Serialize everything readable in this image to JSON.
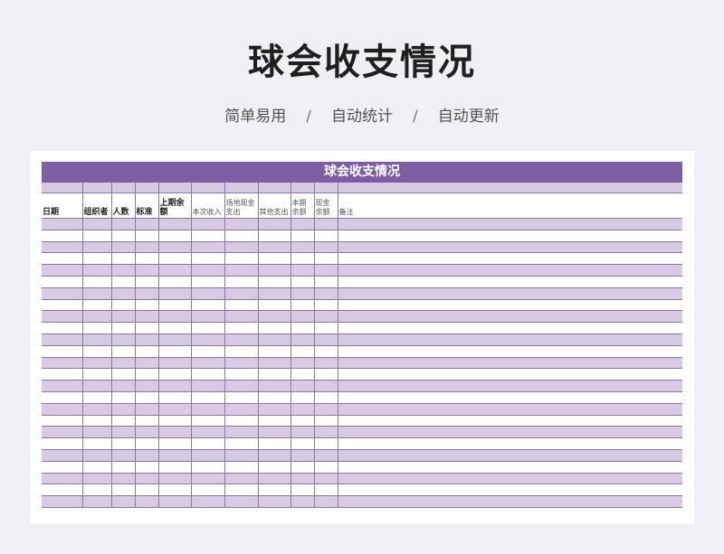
{
  "page": {
    "title": "球会收支情况",
    "tags": [
      "简单易用",
      "自动统计",
      "自动更新"
    ],
    "separator": "/"
  },
  "sheet": {
    "title": "球会收支情况",
    "columns": [
      "日期",
      "组织者",
      "人数",
      "标准",
      "上期余额",
      "本次收入",
      "场地现金支出",
      "其他支出",
      "本期余额",
      "现金余额",
      "备注"
    ],
    "row_count": 25
  },
  "colors": {
    "header_purple": "#7e5ea2",
    "row_lavender": "#d6cbe3",
    "grid_line": "#8d74ab"
  }
}
